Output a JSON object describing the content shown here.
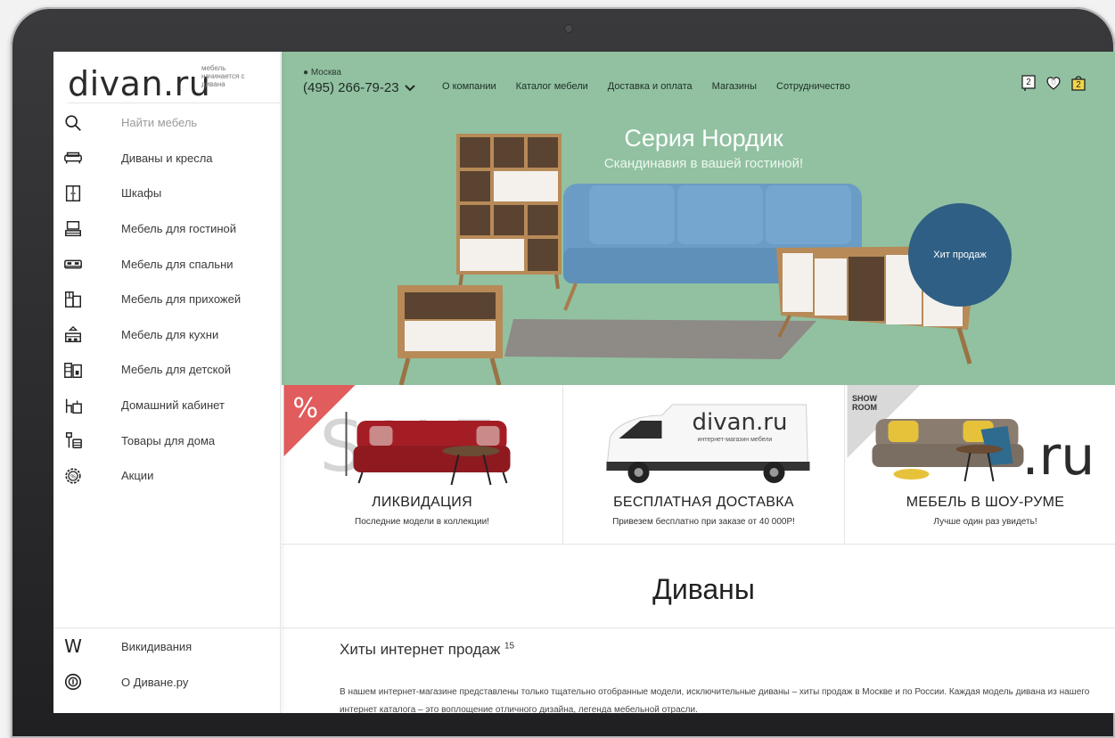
{
  "brand": {
    "logo": "divan.ru",
    "tagline": "мебель начинается с дивана"
  },
  "sidebar": {
    "search_placeholder": "Найти мебель",
    "items": [
      {
        "label": "Диваны и кресла",
        "icon": "sofa-icon"
      },
      {
        "label": "Шкафы",
        "icon": "wardrobe-icon"
      },
      {
        "label": "Мебель для гостиной",
        "icon": "tv-stand-icon"
      },
      {
        "label": "Мебель для спальни",
        "icon": "bed-icon"
      },
      {
        "label": "Мебель для прихожей",
        "icon": "hallway-icon"
      },
      {
        "label": "Мебель для кухни",
        "icon": "kitchen-icon"
      },
      {
        "label": "Мебель для детской",
        "icon": "kids-room-icon"
      },
      {
        "label": "Домашний кабинет",
        "icon": "desk-icon"
      },
      {
        "label": "Товары для дома",
        "icon": "home-goods-icon"
      },
      {
        "label": "Акции",
        "icon": "sale-gear-icon"
      }
    ],
    "bottom": [
      {
        "label": "Викидивания",
        "glyph": "W"
      },
      {
        "label": "О Диване.ру",
        "icon": "about-icon"
      }
    ]
  },
  "header": {
    "city": "Москва",
    "phone": "(495) 266-79-23",
    "nav": [
      "О компании",
      "Каталог мебели",
      "Доставка и оплата",
      "Магазины",
      "Сотрудничество"
    ],
    "compare_count": "2",
    "favorites_count": "0",
    "cart_count": "2"
  },
  "hero": {
    "title": "Серия Нордик",
    "subtitle": "Скандинавия в вашей гостиной!",
    "badge": "Хит продаж",
    "bg_color": "#91c1a1"
  },
  "promos": [
    {
      "title": "ЛИКВИДАЦИЯ",
      "subtitle": "Последние модели в коллекции!",
      "corner": "%",
      "art_text": "SALE"
    },
    {
      "title": "БЕСПЛАТНАЯ ДОСТАВКА",
      "subtitle": "Привезем бесплатно при заказе от 40 000Р!",
      "van_logo": "divan.ru",
      "van_tag": "интернет-магазин мебели"
    },
    {
      "title": "МЕБЕЛЬ В ШОУ-РУМЕ",
      "subtitle": "Лучше один раз увидеть!",
      "corner": "SHOW ROOM",
      "art_text": ".ru"
    }
  ],
  "content": {
    "section_title": "Диваны",
    "subheading": "Хиты интернет продаж",
    "subheading_count": "15",
    "description": "В нашем интернет-магазине представлены только тщательно отобранные модели, исключительные диваны – хиты продаж в Москве и по России. Каждая модель дивана из нашего интернет каталога – это воплощение отличного дизайна, легенда мебельной отрасли."
  }
}
